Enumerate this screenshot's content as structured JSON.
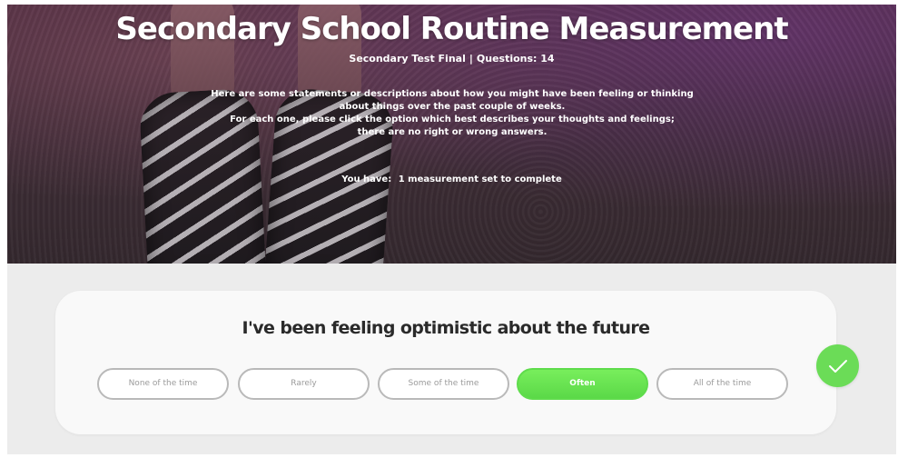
{
  "header": {
    "title": "Secondary School Routine Measurement",
    "test_name": "Secondary Test Final",
    "separator": "|",
    "questions_label": "Questions: 14",
    "instructions": [
      "Here are some statements or descriptions about how you might have been feeling or thinking",
      "about things over the past couple of weeks.",
      "For each one, please click the option which best describes your thoughts and feelings;",
      "there are no right or wrong answers."
    ],
    "remaining_prefix": "You have:",
    "remaining_value": "1 measurement set to complete"
  },
  "question": {
    "text": "I've been feeling optimistic about the future",
    "options": [
      {
        "label": "None of the time",
        "selected": false
      },
      {
        "label": "Rarely",
        "selected": false
      },
      {
        "label": "Some of the time",
        "selected": false
      },
      {
        "label": "Often",
        "selected": true
      },
      {
        "label": "All of the time",
        "selected": false
      }
    ]
  },
  "submit": {
    "icon": "checkmark-icon",
    "color": "#6bdc57"
  },
  "colors": {
    "selected_option": "#5bd948",
    "option_border": "#b9b9b9",
    "section_bg": "#ececec"
  }
}
